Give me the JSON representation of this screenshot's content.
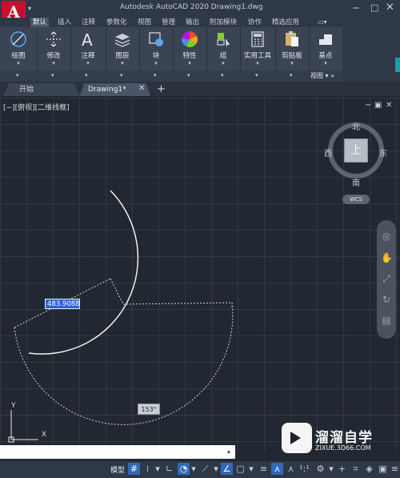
{
  "titlebar": {
    "app_title": "Autodesk AutoCAD 2020   Drawing1.dwg",
    "logo": "A",
    "minimize": "─",
    "maximize": "□",
    "close": "✕"
  },
  "ribbon": {
    "tabs": [
      "默认",
      "插入",
      "注释",
      "参数化",
      "视图",
      "管理",
      "输出",
      "附加模块",
      "协作",
      "精选应用"
    ],
    "extra": "▭▾",
    "groups": [
      {
        "label": "绘图",
        "icon": "draw-icon"
      },
      {
        "label": "修改",
        "icon": "modify-icon"
      },
      {
        "label": "注释",
        "icon": "annotate-icon"
      },
      {
        "label": "图层",
        "icon": "layers-icon"
      },
      {
        "label": "块",
        "icon": "block-icon"
      },
      {
        "label": "特性",
        "icon": "properties-icon"
      },
      {
        "label": "组",
        "icon": "group-icon"
      },
      {
        "label": "实用工具",
        "icon": "utilities-icon"
      },
      {
        "label": "剪贴板",
        "icon": "clipboard-icon"
      },
      {
        "label": "基点",
        "icon": "basepoint-icon"
      }
    ],
    "view_footer": "视图 ▾  »"
  },
  "file_tabs": {
    "start": "开始",
    "drawing": "Drawing1*",
    "close": "✕",
    "add": "+"
  },
  "viewport": {
    "label": "[−][俯视][二维线框]",
    "controls": [
      "−",
      "▣",
      "✕"
    ]
  },
  "viewcube": {
    "north": "北",
    "south": "南",
    "east": "东",
    "west": "西",
    "face": "上",
    "wcs": "WCS"
  },
  "drawing": {
    "length_input": "483.9088",
    "angle_tooltip": "153°"
  },
  "ucs": {
    "y_label": "Y",
    "x_label": "X"
  },
  "status": {
    "model": "模型"
  },
  "watermark": {
    "title": "溜溜自学",
    "url": "ZIXUE.3D66.COM"
  }
}
